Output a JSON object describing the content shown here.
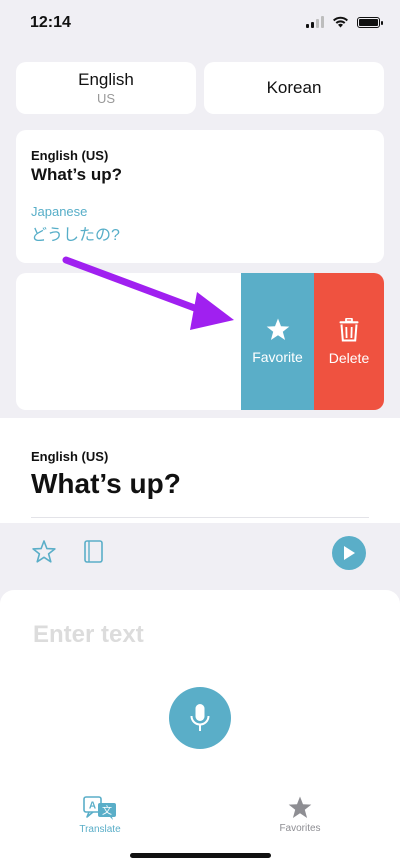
{
  "status": {
    "time": "12:14"
  },
  "languages": {
    "source": {
      "name": "English",
      "region": "US"
    },
    "target": {
      "name": "Korean"
    }
  },
  "history": [
    {
      "source_lang": "English (US)",
      "source_text": "What’s up?",
      "target_lang": "Japanese",
      "target_text": "どうしたの?"
    }
  ],
  "swipe_actions": {
    "favorite_label": "Favorite",
    "delete_label": "Delete"
  },
  "result": {
    "lang": "English (US)",
    "text": "What’s up?"
  },
  "input": {
    "placeholder": "Enter text",
    "value": ""
  },
  "tabs": [
    {
      "label": "Translate",
      "icon": "translate-icon",
      "active": true
    },
    {
      "label": "Favorites",
      "icon": "star-icon",
      "active": false
    }
  ],
  "colors": {
    "accent": "#5aaec8",
    "delete": "#ef5240",
    "annotation_arrow": "#a020f0"
  }
}
